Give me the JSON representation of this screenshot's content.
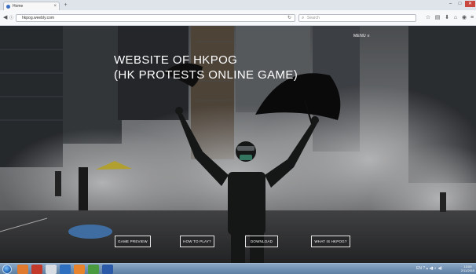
{
  "browser": {
    "tab_title": "Home",
    "tab_close": "×",
    "new_tab": "+",
    "url": "hkpog.weebly.com",
    "reload_icon": "↻",
    "search_placeholder": "Search",
    "window_min": "–",
    "window_max": "□",
    "window_close": "✕"
  },
  "site": {
    "menu_label": "MENU ≡",
    "title_line1": "WEBSITE OF HKPOG",
    "title_line2": "(HK PROTESTS ONLINE GAME)",
    "buttons": [
      "GAME PREVIEW",
      "HOW TO PLAY?",
      "DOWNLOAD",
      "WHAT IS HKPOG?"
    ]
  },
  "taskbar": {
    "tray": "EN ? ▴ ◂▮ ◐ ◀)",
    "clock_time": "13:09",
    "clock_date": "2/11/2015"
  },
  "colors": {
    "accent_close": "#c9473e",
    "taskbar": "#5d7fa3",
    "hero_text": "#ffffff"
  },
  "icons": [
    "back-icon",
    "site-info-icon",
    "reload-icon",
    "search-icon",
    "star-icon",
    "reading-list-icon",
    "download-icon",
    "home-icon",
    "chat-icon",
    "menu-icon"
  ]
}
